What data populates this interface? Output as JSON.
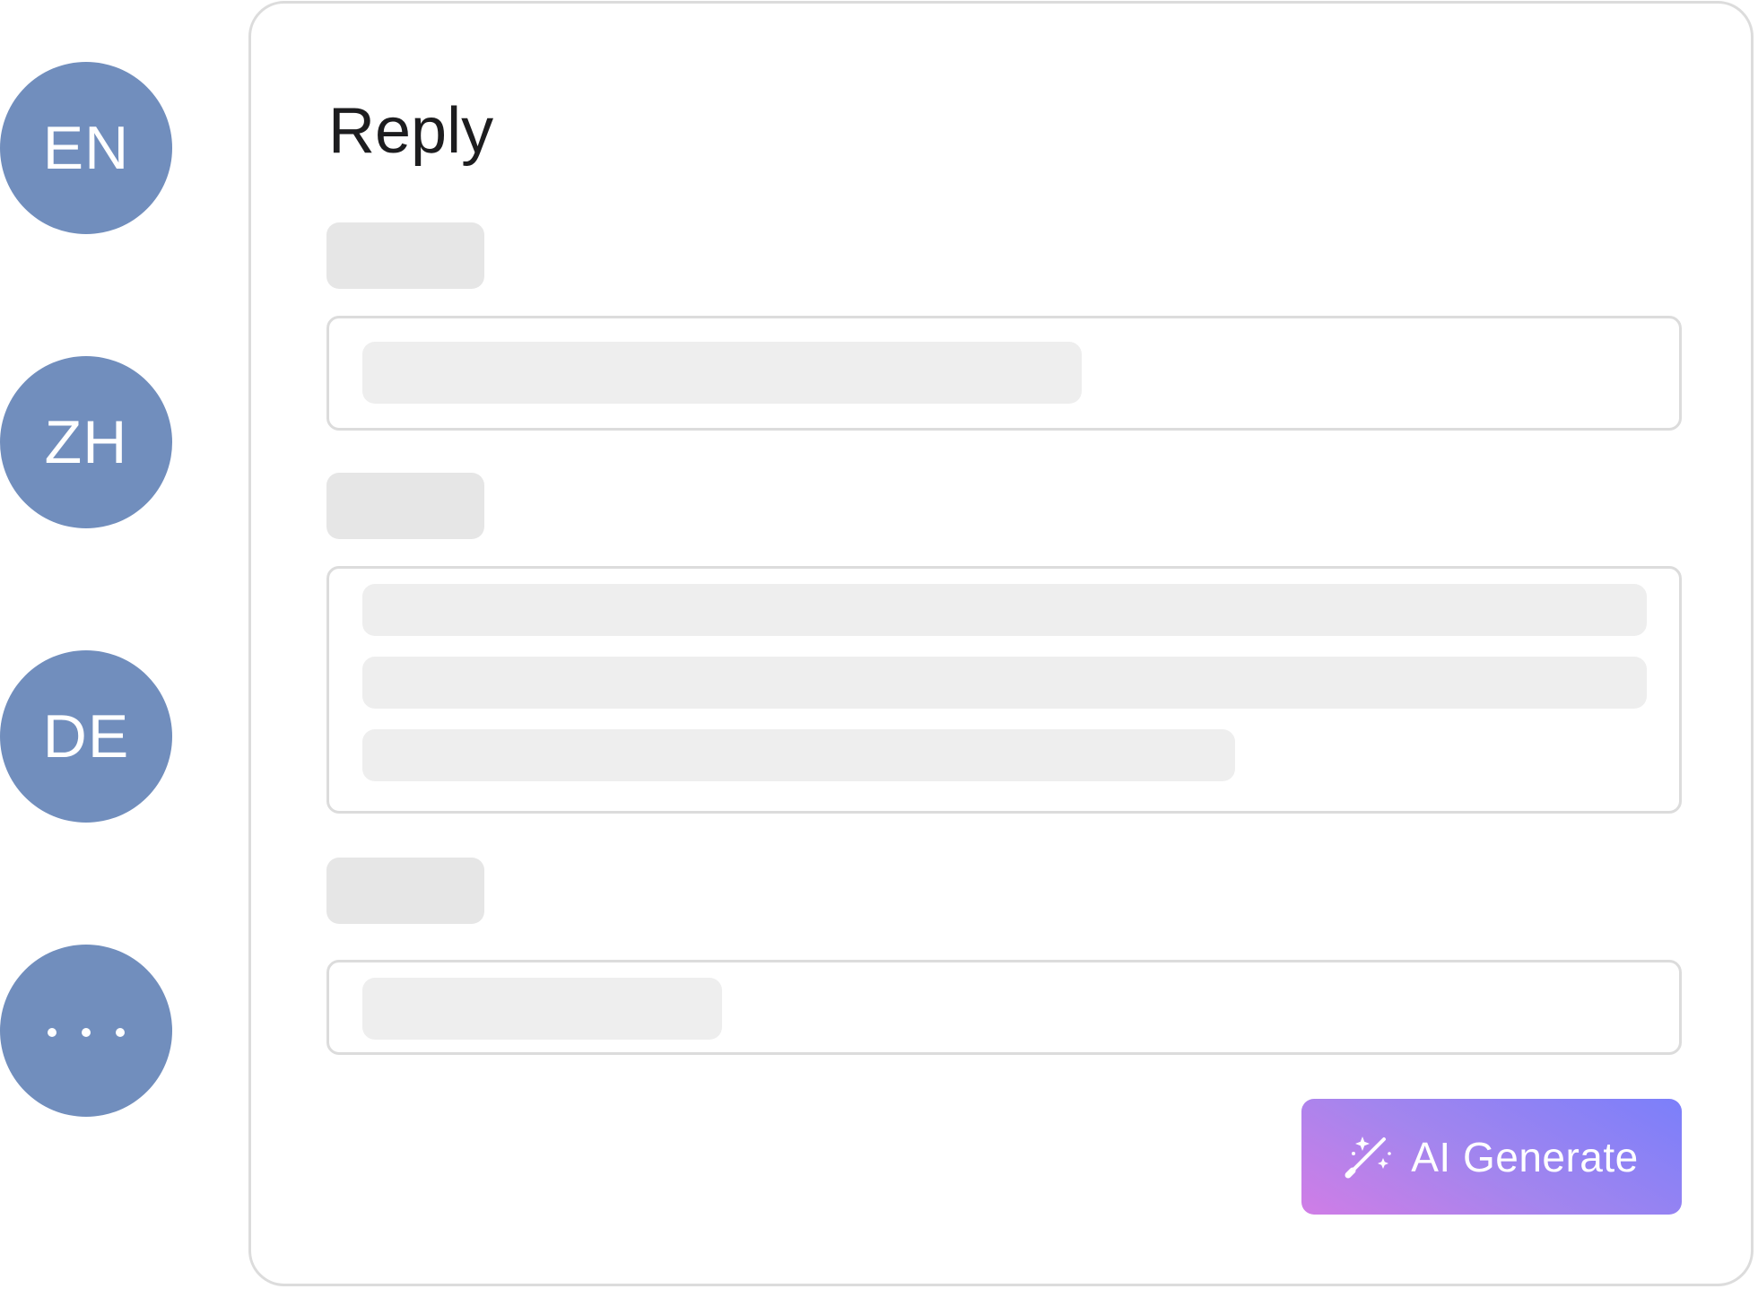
{
  "languages": [
    {
      "code": "EN",
      "label": "EN"
    },
    {
      "code": "ZH",
      "label": "ZH"
    },
    {
      "code": "DE",
      "label": "DE"
    }
  ],
  "more_languages": {
    "icon": "more-dots-icon"
  },
  "reply_card": {
    "title": "Reply",
    "generate_button": {
      "label": "AI Generate",
      "icon": "magic-wand-sparkles-icon"
    }
  },
  "colors": {
    "language_button": "#718ebd",
    "card_border": "#dcdcdc",
    "skeleton_label": "#e6e6e6",
    "skeleton_line": "#eeeeee",
    "gradient_start": "#d07de6",
    "gradient_end": "#7b7ffa"
  }
}
